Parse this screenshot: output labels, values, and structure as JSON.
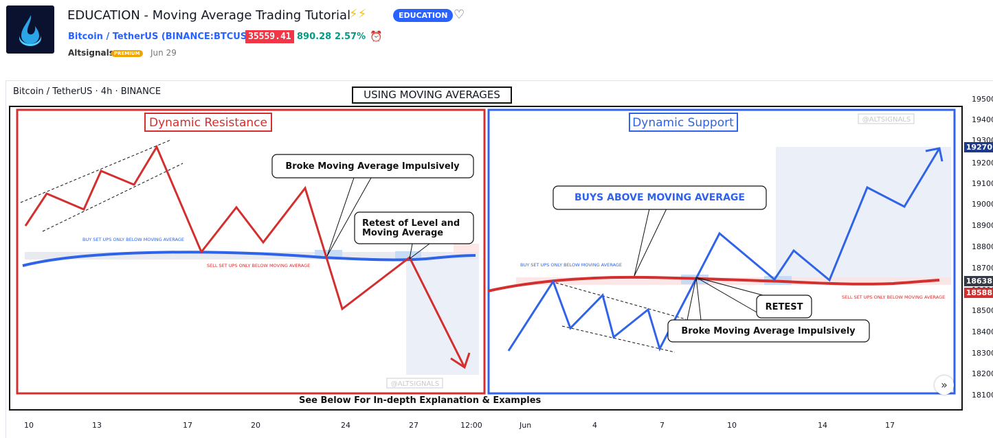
{
  "header": {
    "post_title": "EDUCATION - Moving Average Trading Tutorial",
    "title_emoji": "⚡⚡",
    "category_tag": "EDUCATION",
    "symbol_name": "Bitcoin / TetherUS (BINANCE:BTCUSDT)",
    "price": "35559.41",
    "change": "890.28",
    "change_pct": "2.57%",
    "author": "Altsignals",
    "author_badge": "PREMIUM",
    "date": "Jun 29"
  },
  "chart": {
    "symbol_line": "Bitcoin / TetherUS · 4h · BINANCE",
    "title": "USING MOVING AVERAGES",
    "footer_note": "See Below For In-depth Explanation & Examples",
    "left_panel": {
      "title": "Dynamic Resistance",
      "callout_broke": "Broke Moving Average Impulsively",
      "callout_retest_1": "Retest of Level and",
      "callout_retest_2": "Moving Average",
      "note_buy": "BUY SET UPS ONLY BELOW MOVING AVERAGE",
      "note_sell": "SELL SET UPS ONLY BELOW MOVING AVERAGE",
      "watermark": "@ALTSIGNALS"
    },
    "right_panel": {
      "title": "Dynamic Support",
      "callout_buys": "BUYS ABOVE MOVING AVERAGE",
      "callout_retest": "RETEST",
      "callout_broke": "Broke Moving Average Impulsively",
      "note_buy": "BUY SET UPS ONLY BELOW MOVING AVERAGE",
      "note_sell": "SELL SET UPS ONLY BELOW MOVING AVERAGE",
      "watermark": "@ALTSIGNALS"
    },
    "price_axis": [
      "19500",
      "19400",
      "19300",
      "19200",
      "19100",
      "19000",
      "18900",
      "18800",
      "18700",
      "18600",
      "18500",
      "18400",
      "18300",
      "18200",
      "18100"
    ],
    "price_tags": [
      {
        "text": "19270",
        "color": "#1e3a8a"
      },
      {
        "text": "18638",
        "color": "#363a45"
      },
      {
        "text": "18588",
        "color": "#d32f2f"
      }
    ],
    "time_axis": [
      "10",
      "13",
      "17",
      "20",
      "24",
      "27",
      "12:00",
      "Jun",
      "4",
      "7",
      "10",
      "14",
      "17"
    ],
    "colors": {
      "red": "#d32f2f",
      "blue": "#2f63e8",
      "navy": "#1e3a8a"
    }
  }
}
